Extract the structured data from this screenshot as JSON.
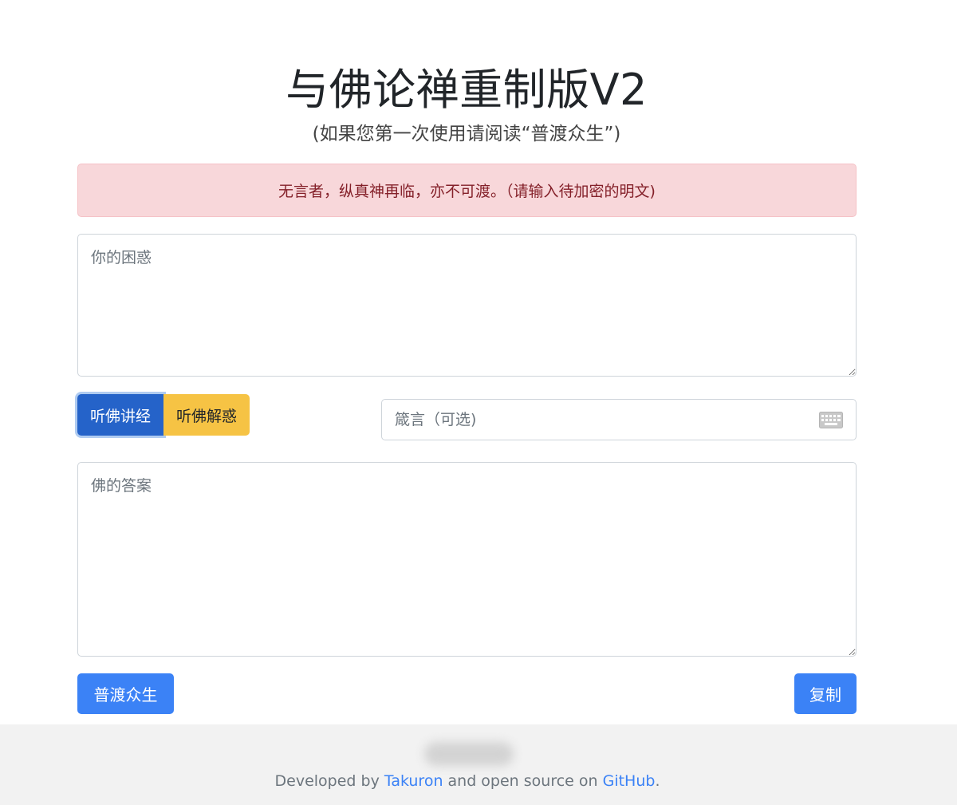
{
  "header": {
    "title": "与佛论禅重制版V2",
    "subtitle": "(如果您第一次使用请阅读“普渡众生”)"
  },
  "alert": {
    "text": "无言者，纵真神再临，亦不可渡。（请输入待加密的明文)"
  },
  "input": {
    "placeholder": "你的困惑",
    "value": ""
  },
  "mode_buttons": {
    "encrypt_label": "听佛讲经",
    "decrypt_label": "听佛解惑"
  },
  "key": {
    "placeholder": "箴言（可选)",
    "value": "",
    "icon": "keyboard-icon"
  },
  "output": {
    "placeholder": "佛的答案",
    "value": ""
  },
  "actions": {
    "guide_label": "普渡众生",
    "copy_label": "复制"
  },
  "footer": {
    "prefix": "Developed by ",
    "author": "Takuron",
    "middle": " and open source on ",
    "repo": "GitHub",
    "suffix": "."
  },
  "colors": {
    "alert_bg": "#f8d7da",
    "alert_text": "#842029",
    "primary": "#3b82f6",
    "active_mode": "#2563c9",
    "warning": "#f6c344",
    "footer_bg": "#f2f2f2"
  }
}
